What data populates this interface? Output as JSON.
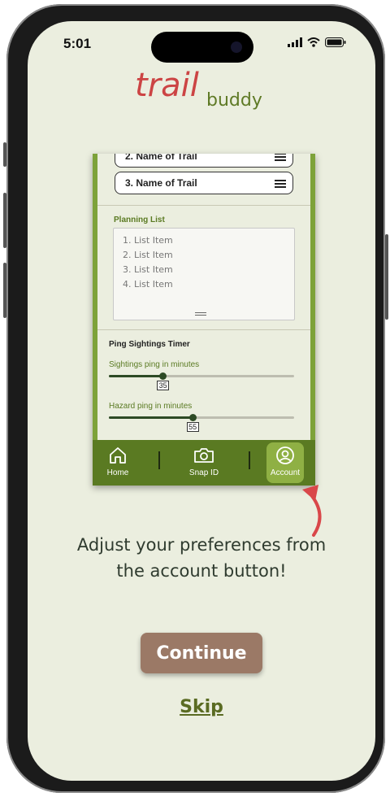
{
  "status_bar": {
    "time": "5:01"
  },
  "logo": {
    "trail": "trail",
    "buddy": "buddy"
  },
  "mock_screen": {
    "trails": [
      "2. Name of Trail",
      "3. Name of Trail"
    ],
    "planning_list": {
      "label": "Planning List",
      "items": [
        "1. List Item",
        "2. List Item",
        "3. List Item",
        "4. List Item"
      ]
    },
    "ping_timer": {
      "label": "Ping Sightings Timer",
      "sightings": {
        "label": "Sightings ping in minutes",
        "value": "35",
        "fraction": 0.29
      },
      "hazard": {
        "label": "Hazard ping in minutes",
        "value": "55",
        "fraction": 0.45
      }
    },
    "nav": {
      "home": "Home",
      "snap": "Snap ID",
      "account": "Account"
    }
  },
  "message": {
    "line1": "Adjust your preferences from",
    "line2": "the account button!"
  },
  "buttons": {
    "continue": "Continue",
    "skip": "Skip"
  },
  "colors": {
    "accent_green": "#7da23a",
    "nav_green": "#5a7a22",
    "continue_brown": "#9b7966",
    "arrow_red": "#d9474a",
    "logo_red": "#cc4444",
    "logo_green": "#5f7a26"
  }
}
